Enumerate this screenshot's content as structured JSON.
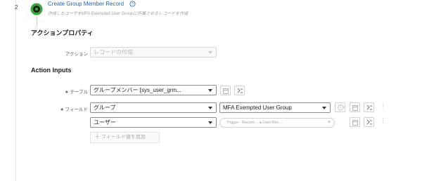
{
  "step": {
    "number": "2",
    "title": "Create Group Member Record",
    "description": "作成したユーザをMFA Exempted User Groupに所属させるレコードを作成"
  },
  "action_properties": {
    "heading": "アクションプロパティ",
    "action_label": "アクション",
    "action_value": "レコードの作成"
  },
  "action_inputs": {
    "heading": "Action Inputs",
    "required_mark": "∗",
    "table_label": "テーブル",
    "table_value": "グループメンバー [sys_user_grm...",
    "fields_label": "フィールド",
    "rows": [
      {
        "field": "グループ",
        "value": "MFA Exempted User Group"
      },
      {
        "field": "ユーザー",
        "pill": "Trigger - Record ... ▸ User Rec...",
        "pill_close": "×"
      }
    ],
    "add_field_button": "十 フィールド値を追加"
  },
  "colors": {
    "link": "#1f62b3",
    "icon_green": "#3aa63a",
    "border": "#8a8f94"
  }
}
